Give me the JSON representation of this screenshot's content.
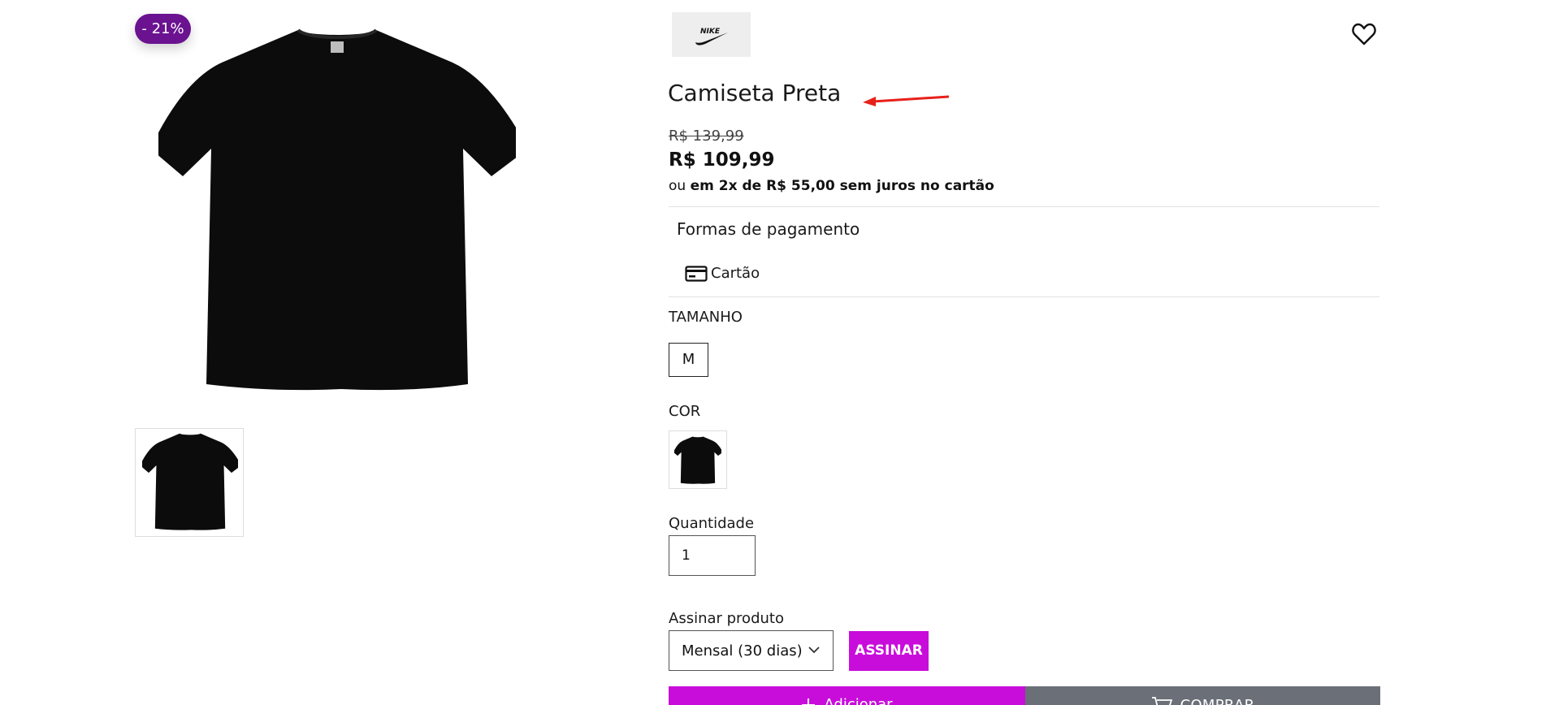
{
  "product": {
    "discount_badge": "- 21%",
    "brand": "NIKE",
    "title": "Camiseta Preta",
    "old_price": "R$ 139,99",
    "price": "R$ 109,99",
    "installments_prefix": "ou",
    "installments_text": "em 2x de R$ 55,00 sem juros no cartão"
  },
  "payment": {
    "title": "Formas de pagamento",
    "method_label": "Cartão",
    "method_icon": "credit-card-icon"
  },
  "size": {
    "label": "TAMANHO",
    "options": [
      "M"
    ]
  },
  "color": {
    "label": "COR",
    "options": [
      "black-tshirt-swatch"
    ]
  },
  "quantity": {
    "label": "Quantidade",
    "value": "1"
  },
  "subscription": {
    "label": "Assinar produto",
    "selected": "Mensal (30 dias)",
    "button": "ASSINAR"
  },
  "actions": {
    "add_label": "Adicionar",
    "buy_label": "COMPRAR"
  },
  "colors": {
    "badge": "#6a1290",
    "accent": "#c80ddb",
    "buy_button": "#6a6f78",
    "annotation_arrow": "#e8201a"
  }
}
